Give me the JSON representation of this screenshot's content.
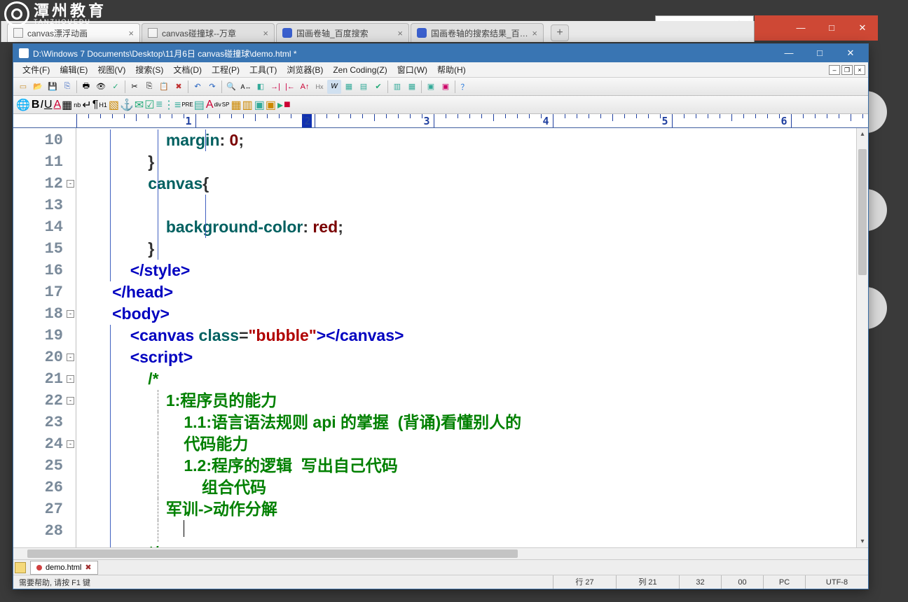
{
  "watermark": {
    "cn": "潭州教育",
    "en": "TANZHOUEDU"
  },
  "redwin": {
    "min": "—",
    "max": "□",
    "close": "✕"
  },
  "browser": {
    "tabs": [
      {
        "label": "canvas漂浮动画",
        "fav": "page"
      },
      {
        "label": "canvas碰撞球--万章",
        "fav": "page"
      },
      {
        "label": "国画卷轴_百度搜索",
        "fav": "baidu"
      },
      {
        "label": "国画卷轴的搜索结果_百度...",
        "fav": "baidu"
      }
    ],
    "controls": {
      "min": "—",
      "max": "□",
      "close": "✕"
    }
  },
  "editor": {
    "title": "D:\\Windows 7 Documents\\Desktop\\11月6日 canvas碰撞球\\demo.html *",
    "menu": [
      "文件(F)",
      "编辑(E)",
      "视图(V)",
      "搜索(S)",
      "文档(D)",
      "工程(P)",
      "工具(T)",
      "浏览器(B)",
      "Zen Coding(Z)",
      "窗口(W)",
      "帮助(H)"
    ],
    "doctab": {
      "label": "demo.html"
    },
    "status": {
      "help": "需要帮助, 请按 F1 键",
      "line": "行 27",
      "col": "列 21",
      "v1": "32",
      "v2": "00",
      "pc": "PC",
      "enc": "UTF-8"
    },
    "wincontrols": {
      "min": "—",
      "max": "□",
      "close": "✕"
    },
    "ruler_numbers": [
      "1",
      "2",
      "3",
      "4",
      "5",
      "6"
    ],
    "lines": [
      {
        "n": "10"
      },
      {
        "n": "11"
      },
      {
        "n": "12",
        "f": "-"
      },
      {
        "n": "13"
      },
      {
        "n": "14"
      },
      {
        "n": "15"
      },
      {
        "n": "16"
      },
      {
        "n": "17"
      },
      {
        "n": "18",
        "f": "-"
      },
      {
        "n": "19"
      },
      {
        "n": "20",
        "f": "-"
      },
      {
        "n": "21",
        "f": "-"
      },
      {
        "n": "22",
        "f": "-"
      },
      {
        "n": "23"
      },
      {
        "n": "24",
        "f": "-"
      },
      {
        "n": "25"
      },
      {
        "n": "26"
      },
      {
        "n": "27"
      },
      {
        "n": "28"
      }
    ],
    "code": {
      "l10_prop": "margin",
      "l10_punc1": ":",
      "l10_val": " 0",
      "l10_punc2": ";",
      "l11": "}",
      "l12_sel": "canvas",
      "l12_brace": "{",
      "l14_prop": "background-color",
      "l14_punc1": ":",
      "l14_val": " red",
      "l14_punc2": ";",
      "l15": "}",
      "l16": "</style>",
      "l17": "</head>",
      "l18": "<body>",
      "l19_t1": "<canvas ",
      "l19_attr": "class",
      "l19_eq": "=",
      "l19_str": "\"bubble\"",
      "l19_t2": "></canvas>",
      "l20": "<script>",
      "l21": "/*",
      "l22": "1:程序员的能力",
      "l23a": "1.1:语言语法规则 api 的掌握  (背诵)看懂别人的",
      "l23b": "代码能力",
      "l24": "1.2:程序的逻辑  写出自己代码",
      "l25": "组合代码",
      "l26": "军训->动作分解",
      "l28": "*/"
    }
  }
}
